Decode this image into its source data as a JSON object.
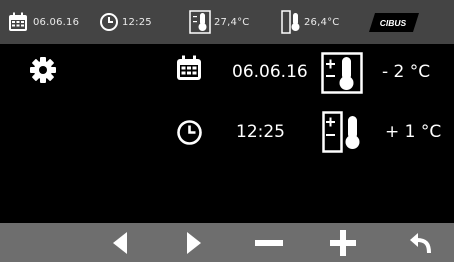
{
  "status_bar": {
    "date": "06.06.16",
    "time": "12:25",
    "inside_temp": "27,4°C",
    "outside_temp": "26,4°C",
    "brand": "CIBUS"
  },
  "settings": {
    "date": "06.06.16",
    "time": "12:25",
    "inside_temp_offset": "- 2 °C",
    "outside_temp_offset": "+ 1 °C"
  },
  "icons": {
    "settings": "gear-icon",
    "date": "calendar-icon",
    "time": "clock-icon",
    "inside_temp": "thermometer-panel-icon",
    "outside_temp": "thermometer-panel-icon",
    "nav_left": "triangle-left-icon",
    "nav_right": "triangle-right-icon",
    "minus": "minus-icon",
    "plus": "plus-icon",
    "back": "back-arrow-icon"
  },
  "colors": {
    "top_bar": "#444444",
    "bottom_bar": "#6e6e6e",
    "background": "#000000",
    "foreground": "#ffffff"
  }
}
